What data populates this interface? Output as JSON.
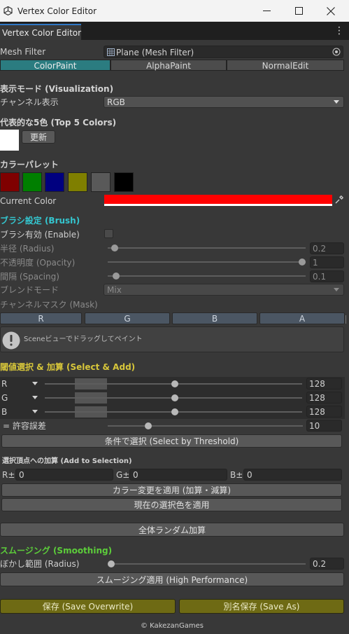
{
  "window": {
    "title": "Vertex Color Editor"
  },
  "tab": {
    "label": "Vertex Color Editor"
  },
  "mesh_filter": {
    "label": "Mesh Filter",
    "value": "Plane (Mesh Filter)"
  },
  "mode_tabs": [
    {
      "label": "ColorPaint",
      "active": true
    },
    {
      "label": "AlphaPaint",
      "active": false
    },
    {
      "label": "NormalEdit",
      "active": false
    }
  ],
  "visualization": {
    "header": "表示モード (Visualization)",
    "channel_label": "チャンネル表示",
    "channel_value": "RGB"
  },
  "top_colors": {
    "header": "代表的な5色 (Top 5 Colors)",
    "refresh_label": "更新"
  },
  "palette": {
    "header": "カラーパレット",
    "colors": [
      "#7f0000",
      "#007f00",
      "#00007f",
      "#7f7f00",
      "#595959",
      "#000000"
    ],
    "current_label": "Current Color",
    "current_color": "#ff0000"
  },
  "brush": {
    "header": "ブラシ設定 (Brush)",
    "enable_label": "ブラシ有効 (Enable)",
    "radius_label": "半径 (Radius)",
    "radius_value": "0.2",
    "opacity_label": "不透明度 (Opacity)",
    "opacity_value": "1",
    "spacing_label": "間隔 (Spacing)",
    "spacing_value": "0.1",
    "blend_label": "ブレンドモード",
    "blend_value": "Mix",
    "mask_label": "チャンネルマスク (Mask)",
    "mask_channels": [
      "R",
      "G",
      "B",
      "A"
    ],
    "hint": "Sceneビューでドラッグしてペイント"
  },
  "threshold": {
    "header": "閾値選択 & 加算 (Select & Add)",
    "rows": [
      {
        "label": "R",
        "value": "128"
      },
      {
        "label": "G",
        "value": "128"
      },
      {
        "label": "B",
        "value": "128"
      }
    ],
    "tolerance_label": "= 許容誤差",
    "tolerance_value": "10",
    "select_button": "条件で選択 (Select by Threshold)"
  },
  "add_to_selection": {
    "header": "選択頂点への加算 (Add to Selection)",
    "fields": [
      {
        "label": "R±",
        "value": "0"
      },
      {
        "label": "G±",
        "value": "0"
      },
      {
        "label": "B±",
        "value": "0"
      }
    ],
    "apply_button": "カラー変更を適用 (加算・減算)",
    "apply_current_button": "現在の選択色を適用"
  },
  "random_button": "全体ランダム加算",
  "smoothing": {
    "header": "スムージング (Smoothing)",
    "radius_label": "ぼかし範囲 (Radius)",
    "radius_value": "0.2",
    "apply_button": "スムージング適用 (High Performance)"
  },
  "save": {
    "overwrite_label": "保存 (Save Overwrite)",
    "save_as_label": "別名保存 (Save As)"
  },
  "footer": "© KakezanGames"
}
